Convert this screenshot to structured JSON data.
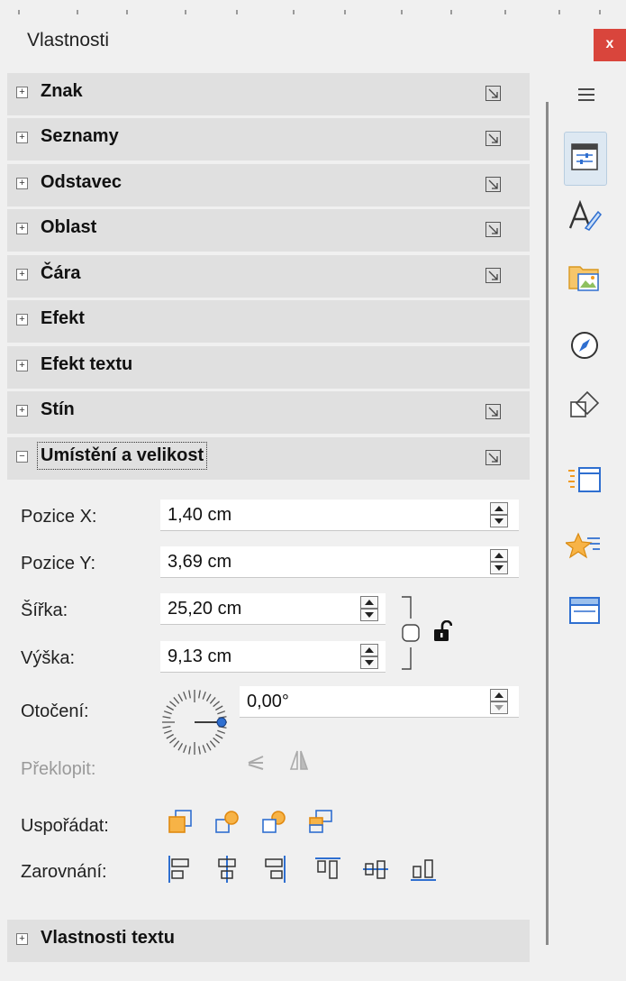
{
  "window": {
    "title": "Vlastnosti",
    "close_label": "x"
  },
  "sections": [
    {
      "label": "Znak",
      "expanded": false,
      "has_more": true
    },
    {
      "label": "Seznamy",
      "expanded": false,
      "has_more": true
    },
    {
      "label": "Odstavec",
      "expanded": false,
      "has_more": true
    },
    {
      "label": "Oblast",
      "expanded": false,
      "has_more": true
    },
    {
      "label": "Čára",
      "expanded": false,
      "has_more": true
    },
    {
      "label": "Efekt",
      "expanded": false,
      "has_more": false
    },
    {
      "label": "Efekt textu",
      "expanded": false,
      "has_more": false
    },
    {
      "label": "Stín",
      "expanded": false,
      "has_more": true
    },
    {
      "label": "Umístění a velikost",
      "expanded": true,
      "has_more": true
    },
    {
      "label": "Vlastnosti textu",
      "expanded": false,
      "has_more": false
    }
  ],
  "position_size": {
    "pos_x": {
      "label": "Pozice X:",
      "value": "1,40 cm"
    },
    "pos_y": {
      "label": "Pozice Y:",
      "value": "3,69 cm"
    },
    "width": {
      "label": "Šířka:",
      "value": "25,20 cm"
    },
    "height": {
      "label": "Výška:",
      "value": "9,13 cm"
    },
    "rotation": {
      "label": "Otočení:",
      "value": "0,00°"
    },
    "flip": {
      "label": "Překlopit:"
    },
    "arrange": {
      "label": "Uspořádat:"
    },
    "align": {
      "label": "Zarovnání:"
    }
  },
  "sidebar_tabs": [
    "menu-icon",
    "properties-icon",
    "styles-icon",
    "gallery-icon",
    "navigator-icon",
    "shapes-icon",
    "slide-transition-icon",
    "animation-icon",
    "master-slides-icon"
  ],
  "colors": {
    "accent": "#2f6fd0",
    "arrange_orange": "#f29a1e",
    "close_red": "#d9453c",
    "section_bg": "#e0e0e0"
  }
}
